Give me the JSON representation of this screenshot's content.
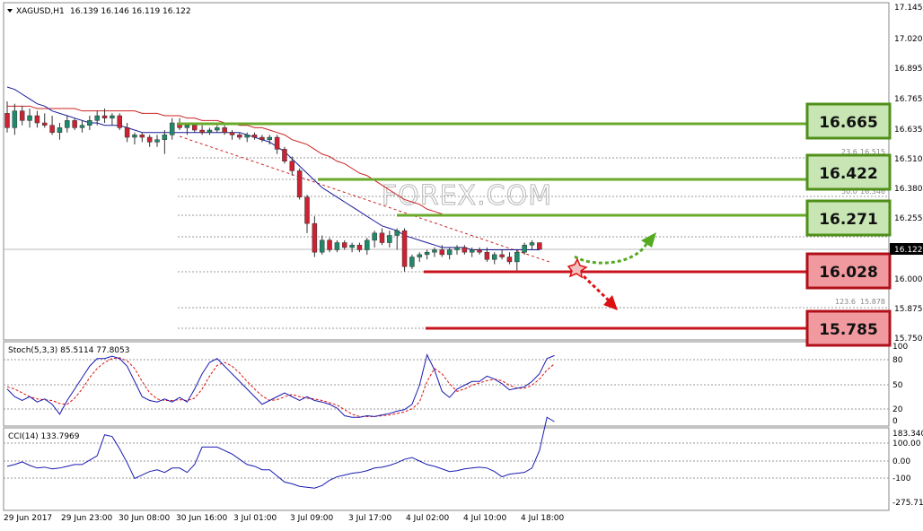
{
  "header": {
    "symbol": "XAGUSD,H1",
    "ohlc": "16.139 16.146 16.119 16.122"
  },
  "price_axis": {
    "ticks": [
      "17.145",
      "17.020",
      "16.895",
      "16.765",
      "16.635",
      "16.510",
      "16.380",
      "16.255",
      "16.122",
      "16.000",
      "15.875",
      "15.750"
    ],
    "current": "16.122"
  },
  "time_axis": {
    "labels": [
      "29 Jun 2017",
      "29 Jun 23:00",
      "30 Jun 08:00",
      "30 Jun 16:00",
      "3 Jul 01:00",
      "3 Jul 09:00",
      "3 Jul 17:00",
      "4 Jul 02:00",
      "4 Jul 10:00",
      "4 Jul 18:00"
    ]
  },
  "levels": {
    "resistance": [
      "16.665",
      "16.422",
      "16.271"
    ],
    "support": [
      "16.028",
      "15.785"
    ]
  },
  "fib_labels": [
    "23.6",
    "16.515",
    "50.0",
    "16.346",
    "123.6",
    "15.878"
  ],
  "watermark": "FOREX.COM",
  "stoch": {
    "title": "Stoch(5,3,3) 85.5114 77.8053",
    "ticks": [
      "100",
      "80",
      "50",
      "20",
      "0"
    ]
  },
  "cci": {
    "title": "CCI(14) 133.7969",
    "ticks": [
      "183.340",
      "100.00",
      "0.00",
      "-100",
      "-275.71"
    ]
  },
  "colors": {
    "bull": "#1f8a6b",
    "bear": "#cc2233",
    "resistance": "#6aaa2a",
    "support": "#c8141e",
    "resistance_box": "#c8e6b4",
    "support_box": "#f09aa0",
    "ma_fast": "#1a1a9a",
    "ma_slow": "#cc2222",
    "grid": "#aaaaaa",
    "green_arrow": "#55aa22",
    "red_arrow": "#dd1111"
  },
  "chart_data": {
    "type": "candlestick",
    "interval": "H1",
    "candles": [
      [
        16.69,
        16.74,
        16.61,
        16.63
      ],
      [
        16.63,
        16.73,
        16.6,
        16.7
      ],
      [
        16.7,
        16.72,
        16.64,
        16.66
      ],
      [
        16.66,
        16.71,
        16.63,
        16.68
      ],
      [
        16.68,
        16.7,
        16.63,
        16.65
      ],
      [
        16.65,
        16.69,
        16.63,
        16.64
      ],
      [
        16.64,
        16.68,
        16.6,
        16.61
      ],
      [
        16.61,
        16.65,
        16.58,
        16.63
      ],
      [
        16.63,
        16.68,
        16.61,
        16.66
      ],
      [
        16.66,
        16.67,
        16.62,
        16.63
      ],
      [
        16.63,
        16.66,
        16.61,
        16.64
      ],
      [
        16.64,
        16.68,
        16.62,
        16.66
      ],
      [
        16.66,
        16.7,
        16.64,
        16.68
      ],
      [
        16.68,
        16.71,
        16.65,
        16.67
      ],
      [
        16.67,
        16.69,
        16.64,
        16.68
      ],
      [
        16.68,
        16.69,
        16.62,
        16.63
      ],
      [
        16.63,
        16.65,
        16.57,
        16.59
      ],
      [
        16.59,
        16.61,
        16.56,
        16.6
      ],
      [
        16.6,
        16.61,
        16.57,
        16.59
      ],
      [
        16.59,
        16.6,
        16.55,
        16.57
      ],
      [
        16.57,
        16.6,
        16.55,
        16.58
      ],
      [
        16.58,
        16.62,
        16.52,
        16.6
      ],
      [
        16.6,
        16.67,
        16.58,
        16.65
      ],
      [
        16.65,
        16.67,
        16.62,
        16.63
      ],
      [
        16.63,
        16.65,
        16.6,
        16.64
      ],
      [
        16.64,
        16.65,
        16.61,
        16.62
      ],
      [
        16.62,
        16.64,
        16.6,
        16.61
      ],
      [
        16.61,
        16.63,
        16.6,
        16.62
      ],
      [
        16.62,
        16.64,
        16.61,
        16.63
      ],
      [
        16.63,
        16.64,
        16.6,
        16.61
      ],
      [
        16.61,
        16.62,
        16.58,
        16.6
      ],
      [
        16.6,
        16.61,
        16.58,
        16.59
      ],
      [
        16.59,
        16.61,
        16.57,
        16.6
      ],
      [
        16.6,
        16.61,
        16.58,
        16.59
      ],
      [
        16.59,
        16.6,
        16.57,
        16.58
      ],
      [
        16.58,
        16.6,
        16.56,
        16.59
      ],
      [
        16.59,
        16.6,
        16.52,
        16.54
      ],
      [
        16.54,
        16.55,
        16.48,
        16.49
      ],
      [
        16.49,
        16.51,
        16.43,
        16.45
      ],
      [
        16.45,
        16.46,
        16.33,
        16.34
      ],
      [
        16.34,
        16.35,
        16.19,
        16.23
      ],
      [
        16.23,
        16.26,
        16.09,
        16.11
      ],
      [
        16.11,
        16.18,
        16.1,
        16.16
      ],
      [
        16.16,
        16.17,
        16.11,
        16.12
      ],
      [
        16.12,
        16.16,
        16.11,
        16.15
      ],
      [
        16.15,
        16.16,
        16.12,
        16.13
      ],
      [
        16.13,
        16.15,
        16.11,
        16.14
      ],
      [
        16.14,
        16.15,
        16.11,
        16.12
      ],
      [
        16.12,
        16.17,
        16.1,
        16.16
      ],
      [
        16.16,
        16.2,
        16.13,
        16.19
      ],
      [
        16.19,
        16.21,
        16.14,
        16.15
      ],
      [
        16.15,
        16.2,
        16.13,
        16.18
      ],
      [
        16.18,
        16.21,
        16.12,
        16.2
      ],
      [
        16.2,
        16.21,
        16.03,
        16.05
      ],
      [
        16.05,
        16.1,
        16.04,
        16.09
      ],
      [
        16.09,
        16.11,
        16.07,
        16.1
      ],
      [
        16.1,
        16.12,
        16.08,
        16.11
      ],
      [
        16.11,
        16.13,
        16.09,
        16.12
      ],
      [
        16.12,
        16.14,
        16.09,
        16.1
      ],
      [
        16.1,
        16.13,
        16.08,
        16.12
      ],
      [
        16.12,
        16.14,
        16.1,
        16.13
      ],
      [
        16.13,
        16.14,
        16.1,
        16.11
      ],
      [
        16.11,
        16.13,
        16.09,
        16.12
      ],
      [
        16.12,
        16.13,
        16.1,
        16.11
      ],
      [
        16.11,
        16.13,
        16.07,
        16.08
      ],
      [
        16.08,
        16.11,
        16.06,
        16.1
      ],
      [
        16.1,
        16.12,
        16.08,
        16.09
      ],
      [
        16.09,
        16.11,
        16.06,
        16.07
      ],
      [
        16.07,
        16.12,
        16.03,
        16.11
      ],
      [
        16.11,
        16.15,
        16.1,
        16.14
      ],
      [
        16.14,
        16.16,
        16.12,
        16.15
      ],
      [
        16.15,
        16.15,
        16.12,
        16.122
      ]
    ],
    "ma_fast": [
      16.8,
      16.79,
      16.77,
      16.75,
      16.73,
      16.72,
      16.7,
      16.69,
      16.68,
      16.67,
      16.66,
      16.65,
      16.65,
      16.64,
      16.64,
      16.64,
      16.63,
      16.62,
      16.61,
      16.61,
      16.61,
      16.61,
      16.61,
      16.61,
      16.61,
      16.61,
      16.61,
      16.61,
      16.61,
      16.61,
      16.61,
      16.61,
      16.6,
      16.59,
      16.58,
      16.57,
      16.55,
      16.53,
      16.5,
      16.47,
      16.44,
      16.41,
      16.38,
      16.36,
      16.34,
      16.32,
      16.3,
      16.28,
      16.26,
      16.24,
      16.22,
      16.21,
      16.2,
      16.18,
      16.17,
      16.16,
      16.15,
      16.14,
      16.13,
      16.13,
      16.13,
      16.13,
      16.12,
      16.12,
      16.12,
      16.12,
      16.12,
      16.12,
      16.12,
      16.12,
      16.12,
      16.12
    ],
    "ma_slow": [
      16.72,
      16.72,
      16.72,
      16.72,
      16.71,
      16.71,
      16.71,
      16.71,
      16.71,
      16.71,
      16.7,
      16.7,
      16.7,
      16.7,
      16.7,
      16.7,
      16.7,
      16.7,
      16.69,
      16.69,
      16.69,
      16.68,
      16.68,
      16.68,
      16.67,
      16.67,
      16.66,
      16.66,
      16.66,
      16.65,
      16.65,
      16.64,
      16.64,
      16.63,
      16.63,
      16.62,
      16.61,
      16.6,
      16.58,
      16.57,
      16.56,
      16.54,
      16.52,
      16.51,
      16.49,
      16.48,
      16.46,
      16.44,
      16.43,
      16.41,
      16.39,
      16.37,
      16.35,
      16.33,
      16.32,
      16.31,
      16.29,
      16.28,
      16.27
    ],
    "stoch_k": [
      45,
      35,
      30,
      35,
      28,
      32,
      25,
      12,
      30,
      45,
      60,
      75,
      85,
      85,
      88,
      85,
      75,
      55,
      35,
      30,
      28,
      32,
      28,
      34,
      28,
      45,
      65,
      80,
      85,
      75,
      65,
      55,
      45,
      35,
      25,
      30,
      35,
      40,
      35,
      30,
      35,
      30,
      28,
      25,
      20,
      10,
      8,
      8,
      10,
      9,
      11,
      13,
      16,
      18,
      25,
      50,
      90,
      70,
      42,
      34,
      45,
      50,
      55,
      55,
      62,
      58,
      52,
      44,
      46,
      48,
      55,
      65,
      85,
      89
    ],
    "stoch_d": [
      48,
      45,
      40,
      35,
      32,
      31,
      30,
      26,
      25,
      33,
      45,
      60,
      72,
      80,
      85,
      86,
      82,
      72,
      55,
      40,
      32,
      30,
      30,
      31,
      30,
      33,
      45,
      62,
      76,
      80,
      75,
      66,
      55,
      45,
      36,
      30,
      31,
      35,
      38,
      35,
      33,
      32,
      30,
      27,
      24,
      18,
      12,
      9,
      9,
      9,
      10,
      11,
      13,
      15,
      19,
      28,
      55,
      72,
      65,
      52,
      42,
      45,
      50,
      53,
      56,
      58,
      56,
      50,
      46,
      46,
      50,
      58,
      70,
      78
    ],
    "cci": [
      -30,
      -20,
      -5,
      -25,
      -40,
      -35,
      -45,
      -40,
      -30,
      -20,
      -20,
      5,
      30,
      150,
      140,
      70,
      -10,
      -100,
      -80,
      -60,
      -50,
      -65,
      -40,
      -40,
      -65,
      -20,
      80,
      80,
      80,
      60,
      40,
      10,
      -20,
      -30,
      -50,
      -50,
      -85,
      -120,
      -130,
      -145,
      -150,
      -155,
      -140,
      -110,
      -90,
      -80,
      -70,
      -65,
      -55,
      -40,
      -35,
      -25,
      -10,
      10,
      20,
      0,
      -20,
      -30,
      -45,
      -60,
      -55,
      -45,
      -40,
      -35,
      -40,
      -60,
      -90,
      -75,
      -70,
      -65,
      -40,
      60,
      250,
      225
    ],
    "levels": {
      "resistance": [
        16.665,
        16.422,
        16.271
      ],
      "support": [
        16.028,
        15.785
      ]
    },
    "ylim": [
      15.73,
      17.17
    ],
    "stoch_ylim": [
      -5,
      105
    ],
    "cci_ylim": [
      -300,
      200
    ]
  }
}
